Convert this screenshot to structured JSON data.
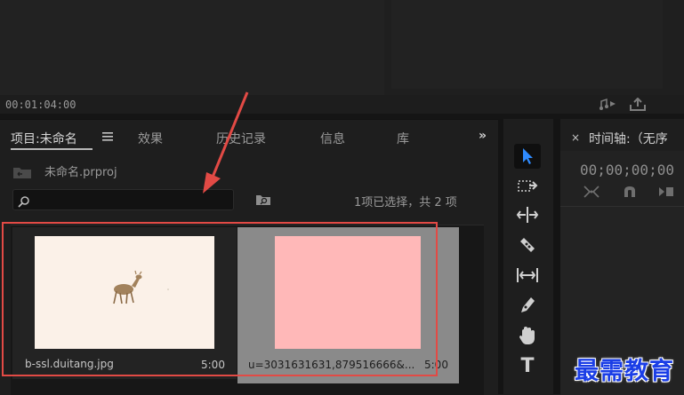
{
  "monitor": {
    "timecode": "00:01:04:00"
  },
  "project_panel": {
    "tabs": [
      {
        "label": "项目:未命名",
        "active": true
      },
      {
        "label": "效果"
      },
      {
        "label": "历史记录"
      },
      {
        "label": "信息"
      },
      {
        "label": "库"
      }
    ],
    "more_label": "»",
    "project_file": "未命名.prproj",
    "search": {
      "value": "",
      "placeholder": ""
    },
    "selection_info": "1项已选择，共 2 项",
    "items": [
      {
        "name": "b-ssl.duitang.jpg",
        "duration": "5:00",
        "thumb_color": "#fbf1e8",
        "selected": false
      },
      {
        "name": "u=3031631631,879516666&...",
        "duration": "5:00",
        "thumb_color": "#ffb8b8",
        "selected": true
      }
    ]
  },
  "toolbar": {
    "type_tool_glyph": "T"
  },
  "timeline": {
    "close_glyph": "×",
    "title": "时间轴:（无序",
    "timecode": "00;00;00;00"
  },
  "watermark": "最需教育",
  "colors": {
    "annotation_red": "#e24a45",
    "selected_tool_blue": "#2f8bff",
    "watermark_blue": "#1b3ee6"
  }
}
